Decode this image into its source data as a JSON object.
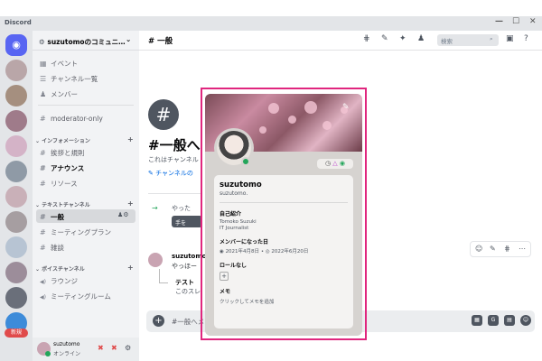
{
  "window": {
    "app_title": "Discord",
    "controls": [
      "—",
      "☐",
      "✕"
    ]
  },
  "server": {
    "name": "suzutomoのコミュニ…",
    "chevron": "⌄"
  },
  "guild_badge": "新規",
  "sidebar": {
    "top_items": [
      {
        "icon": "calendar-icon",
        "glyph": "▦",
        "label": "イベント"
      },
      {
        "icon": "channel-list-icon",
        "glyph": "☰",
        "label": "チャンネル一覧"
      },
      {
        "icon": "members-icon",
        "glyph": "♟",
        "label": "メンバー"
      }
    ],
    "moderator": {
      "glyph": "#",
      "label": "moderator-only"
    },
    "categories": [
      {
        "label": "インフォメーション",
        "items": [
          {
            "glyph": "#",
            "label": "挨拶と規則"
          },
          {
            "glyph": "#",
            "label": "アナウンス"
          },
          {
            "glyph": "#",
            "label": "リソース"
          }
        ]
      },
      {
        "label": "テキストチャンネル",
        "items": [
          {
            "glyph": "#",
            "label": "一般"
          },
          {
            "glyph": "#",
            "label": "ミーティングプラン"
          },
          {
            "glyph": "#",
            "label": "雑談"
          }
        ]
      },
      {
        "label": "ボイスチャンネル",
        "items": [
          {
            "glyph": "◀)",
            "label": "ラウンジ"
          },
          {
            "glyph": "◀)",
            "label": "ミーティングルーム"
          }
        ]
      }
    ],
    "user": {
      "name": "suzutomo",
      "status": "オンライン"
    }
  },
  "header": {
    "channel": "# 一般",
    "search_placeholder": "検索"
  },
  "welcome": {
    "icon_glyph": "#",
    "title": "#一般へ",
    "subtitle": "これはチャンネル",
    "link": "✎ チャンネルの"
  },
  "messages": {
    "system_text": "やった",
    "wave_button": "手を",
    "author": "suzutomo",
    "preview": "やっほー",
    "thread": "テスト",
    "thread_sub": "このスレ"
  },
  "composer": {
    "placeholder": "#一般へメッ"
  },
  "profile": {
    "display_name": "suzutomo",
    "username": "suzutomo.",
    "sections": {
      "about_title": "自己紹介",
      "about_lines": [
        "Tomoko Suzuki",
        "IT Journalist"
      ],
      "member_since_title": "メンバーになった日",
      "discord_date": "2021年4月8日",
      "server_date": "2022年6月20日",
      "roles_title": "ロールなし",
      "note_title": "メモ",
      "note_placeholder": "クリックしてメモを追加"
    }
  },
  "colors": {
    "accent": "#5865f2",
    "highlight_border": "#e0267e",
    "online": "#23a55a"
  }
}
